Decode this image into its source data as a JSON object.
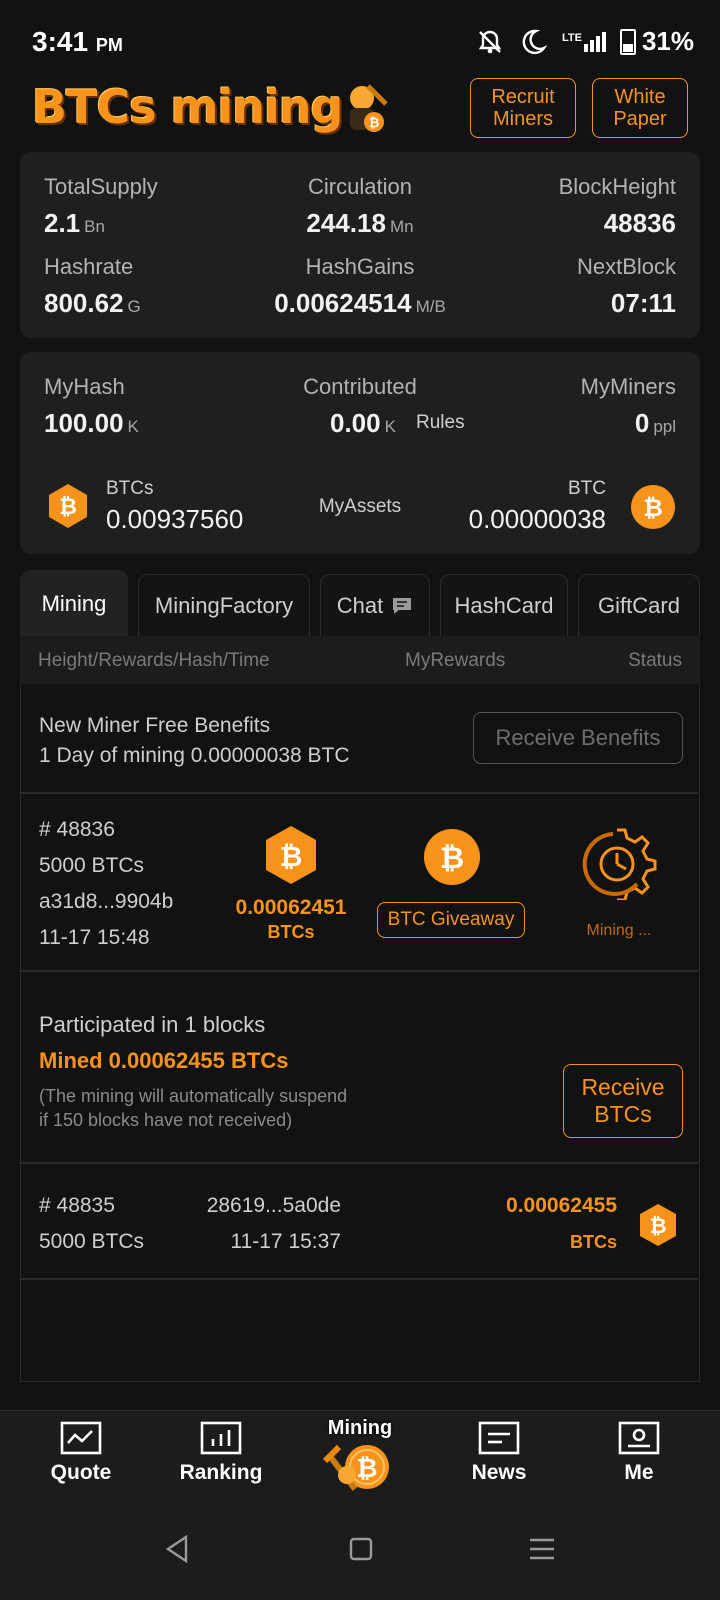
{
  "status_bar": {
    "time": "3:41",
    "ampm": "PM",
    "network": "LTE",
    "battery": "31%"
  },
  "header": {
    "logo_text": "BTCs mining",
    "recruit_label": "Recruit\nMiners",
    "whitepaper_label": "White\nPaper"
  },
  "network_stats": {
    "total_supply_label": "TotalSupply",
    "total_supply_value": "2.1",
    "total_supply_unit": "Bn",
    "circulation_label": "Circulation",
    "circulation_value": "244.18",
    "circulation_unit": "Mn",
    "block_height_label": "BlockHeight",
    "block_height_value": "48836",
    "hashrate_label": "Hashrate",
    "hashrate_value": "800.62",
    "hashrate_unit": "G",
    "hash_gains_label": "HashGains",
    "hash_gains_value": "0.00624514",
    "hash_gains_unit": "M/B",
    "next_block_label": "NextBlock",
    "next_block_value": "07:11"
  },
  "my_stats": {
    "my_hash_label": "MyHash",
    "my_hash_value": "100.00",
    "my_hash_unit": "K",
    "contributed_label": "Contributed",
    "contributed_value": "0.00",
    "contributed_unit": "K",
    "rules_label": "Rules",
    "my_miners_label": "MyMiners",
    "my_miners_value": "0",
    "my_miners_unit": "ppl",
    "btcs_label": "BTCs",
    "btcs_value": "0.00937560",
    "assets_label": "MyAssets",
    "btc_label": "BTC",
    "btc_value": "0.00000038"
  },
  "tabs": [
    {
      "label": "Mining",
      "active": true
    },
    {
      "label": "MiningFactory",
      "active": false
    },
    {
      "label": "Chat",
      "active": false
    },
    {
      "label": "HashCard",
      "active": false
    },
    {
      "label": "GiftCard",
      "active": false
    }
  ],
  "list_header": {
    "col1": "Height/Rewards/Hash/Time",
    "col2": "MyRewards",
    "col3": "Status"
  },
  "benefits": {
    "title": "New Miner Free Benefits",
    "desc": "1 Day of mining 0.00000038 BTC",
    "button": "Receive Benefits"
  },
  "current_block": {
    "height": "# 48836",
    "reward": "5000 BTCs",
    "hash": "a31d8...9904b",
    "time": "11-17 15:48",
    "my_reward": "0.00062451",
    "my_reward_unit": "BTCs",
    "giveaway_label": "BTC Giveaway",
    "status": "Mining ..."
  },
  "participation": {
    "title": "Participated in 1 blocks",
    "mined": "Mined 0.00062455 BTCs",
    "note": "(The mining will automatically suspend\nif 150 blocks have not received)",
    "button": "Receive\nBTCs"
  },
  "past_block": {
    "height": "# 48835",
    "reward": "5000 BTCs",
    "hash": "28619...5a0de",
    "time": "11-17 15:37",
    "my_reward": "0.00062455",
    "my_reward_unit": "BTCs"
  },
  "bottom_nav": [
    {
      "label": "Quote",
      "icon": "chart-icon"
    },
    {
      "label": "Ranking",
      "icon": "bar-chart-icon"
    },
    {
      "label": "Mining",
      "icon": "mining-icon"
    },
    {
      "label": "News",
      "icon": "news-icon"
    },
    {
      "label": "Me",
      "icon": "profile-icon"
    }
  ],
  "colors": {
    "accent": "#f7931a",
    "background": "#121212",
    "card": "#1f1f1f"
  }
}
